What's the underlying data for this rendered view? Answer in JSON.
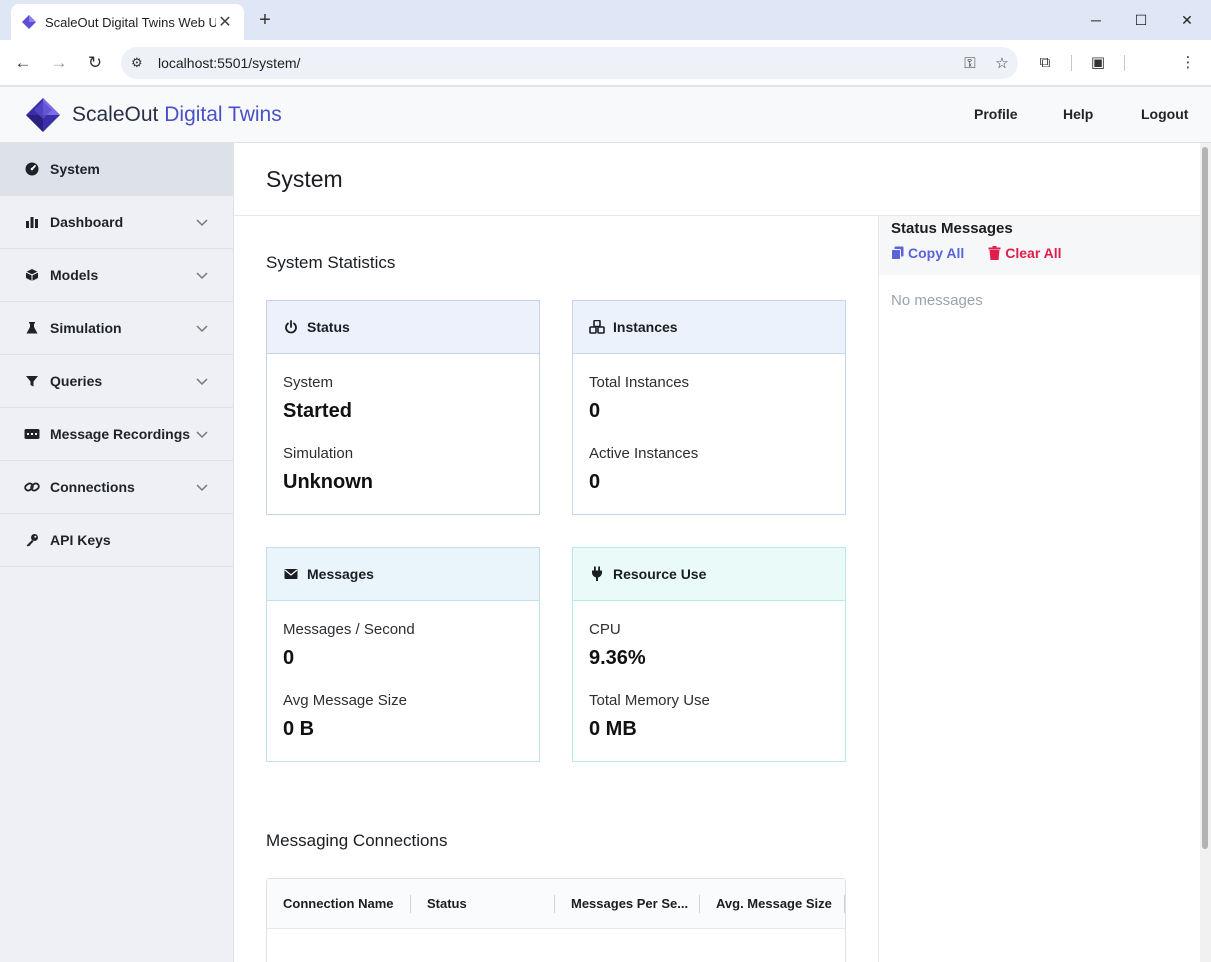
{
  "browser": {
    "tab_title": "ScaleOut Digital Twins Web UI",
    "tab_close": "✕",
    "new_tab": "+",
    "url": "localhost:5501/system/",
    "window_controls": {
      "minimize": "─",
      "maximize": "☐",
      "close": "✕"
    }
  },
  "app": {
    "brand_primary": "ScaleOut",
    "brand_accent": "Digital Twins",
    "header_links": {
      "profile": "Profile",
      "help": "Help",
      "logout": "Logout"
    }
  },
  "sidebar": {
    "items": [
      {
        "label": "System",
        "icon": "gauge-icon",
        "active": true,
        "expandable": false
      },
      {
        "label": "Dashboard",
        "icon": "chart-icon",
        "active": false,
        "expandable": true
      },
      {
        "label": "Models",
        "icon": "cube-icon",
        "active": false,
        "expandable": true
      },
      {
        "label": "Simulation",
        "icon": "flask-icon",
        "active": false,
        "expandable": true
      },
      {
        "label": "Queries",
        "icon": "filter-icon",
        "active": false,
        "expandable": true
      },
      {
        "label": "Message Recordings",
        "icon": "recording-icon",
        "active": false,
        "expandable": true
      },
      {
        "label": "Connections",
        "icon": "link-icon",
        "active": false,
        "expandable": true
      },
      {
        "label": "API Keys",
        "icon": "key-icon",
        "active": false,
        "expandable": false
      }
    ]
  },
  "page": {
    "title": "System",
    "stats_title": "System Statistics",
    "cards": {
      "status": {
        "title": "Status",
        "rows": [
          {
            "label": "System",
            "value": "Started"
          },
          {
            "label": "Simulation",
            "value": "Unknown"
          }
        ]
      },
      "instances": {
        "title": "Instances",
        "rows": [
          {
            "label": "Total Instances",
            "value": "0"
          },
          {
            "label": "Active Instances",
            "value": "0"
          }
        ]
      },
      "messages": {
        "title": "Messages",
        "rows": [
          {
            "label": "Messages / Second",
            "value": "0"
          },
          {
            "label": "Avg Message Size",
            "value": "0 B"
          }
        ]
      },
      "resource": {
        "title": "Resource Use",
        "rows": [
          {
            "label": "CPU",
            "value": "9.36%"
          },
          {
            "label": "Total Memory Use",
            "value": "0 MB"
          }
        ]
      }
    },
    "connections_title": "Messaging Connections",
    "table_columns": [
      "Connection Name",
      "Status",
      "Messages Per Se...",
      "Avg. Message Size"
    ]
  },
  "status_panel": {
    "title": "Status Messages",
    "copy_label": "Copy All",
    "clear_label": "Clear All",
    "empty_text": "No messages"
  },
  "colors": {
    "accent": "#4a50c7",
    "copy": "#5a63d8",
    "clear": "#e01e4b"
  }
}
